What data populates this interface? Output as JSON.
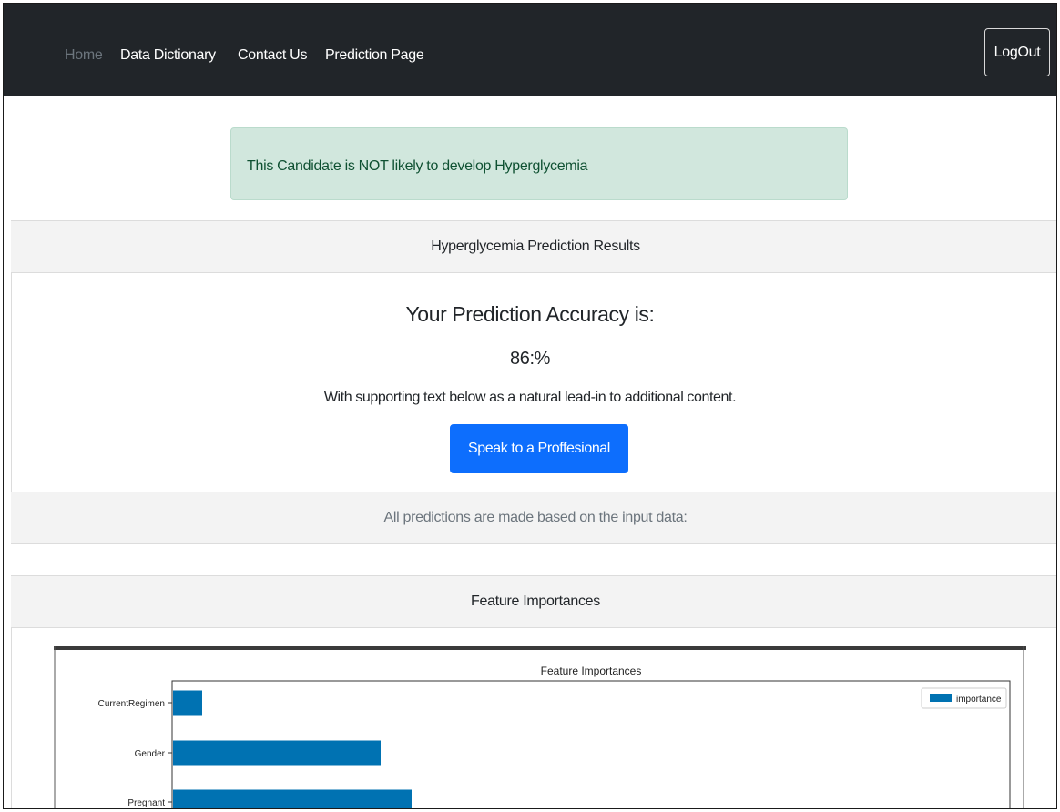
{
  "nav": {
    "links": [
      "Home",
      "Data Dictionary",
      "Contact Us",
      "Prediction Page"
    ],
    "logout_label": "LogOut"
  },
  "alert": {
    "message": "This Candidate is NOT likely to develop Hyperglycemia"
  },
  "results_card": {
    "header": "Hyperglycemia Prediction Results",
    "title": "Your Prediction Accuracy is:",
    "accuracy": "86:%",
    "support_text": "With supporting text below as a natural lead-in to additional content.",
    "button_label": "Speak to a Proffesional",
    "footer": "All predictions are made based on the input data:"
  },
  "features_card": {
    "header": "Feature Importances"
  },
  "colors": {
    "navbar": "#212529",
    "alert_bg": "#d1e7dd",
    "primary": "#0d6efd",
    "bar": "#0072b2"
  },
  "chart_data": {
    "type": "bar",
    "orientation": "horizontal",
    "title": "Feature Importances",
    "categories": [
      "CurrentRegimen",
      "Gender",
      "Pregnant"
    ],
    "series": [
      {
        "name": "importance",
        "values": [
          0.032,
          0.228,
          0.262
        ]
      }
    ],
    "xlim": [
      0,
      0.92
    ],
    "legend": "top-right",
    "grid": false
  }
}
